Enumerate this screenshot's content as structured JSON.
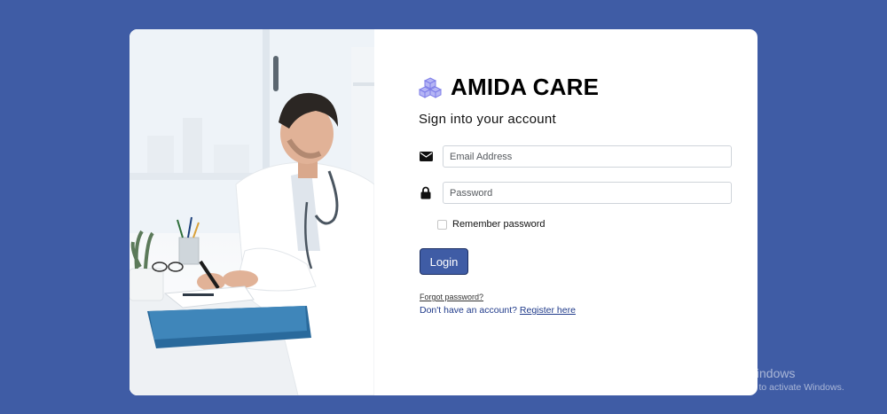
{
  "brand": {
    "title": "AMIDA CARE",
    "logo_icon": "cubes-icon",
    "logo_color": "#8f8ff0"
  },
  "form": {
    "subtitle": "Sign into your account",
    "email": {
      "icon": "envelope-icon",
      "placeholder": "Email Address",
      "value": ""
    },
    "password": {
      "icon": "lock-icon",
      "placeholder": "Password",
      "value": ""
    },
    "remember": {
      "label": "Remember password",
      "checked": false
    },
    "login_label": "Login",
    "forgot_label": "Forgot password?",
    "register_prompt": "Don't have an account?",
    "register_link": "Register here"
  },
  "image": {
    "description_icon": "doctor-photo"
  },
  "watermark": {
    "title": "Activate Windows",
    "subtitle": "Go to Settings to activate Windows."
  },
  "colors": {
    "background": "#3f5ca5",
    "button": "#3f5ca5",
    "link": "#1f3a8a"
  }
}
